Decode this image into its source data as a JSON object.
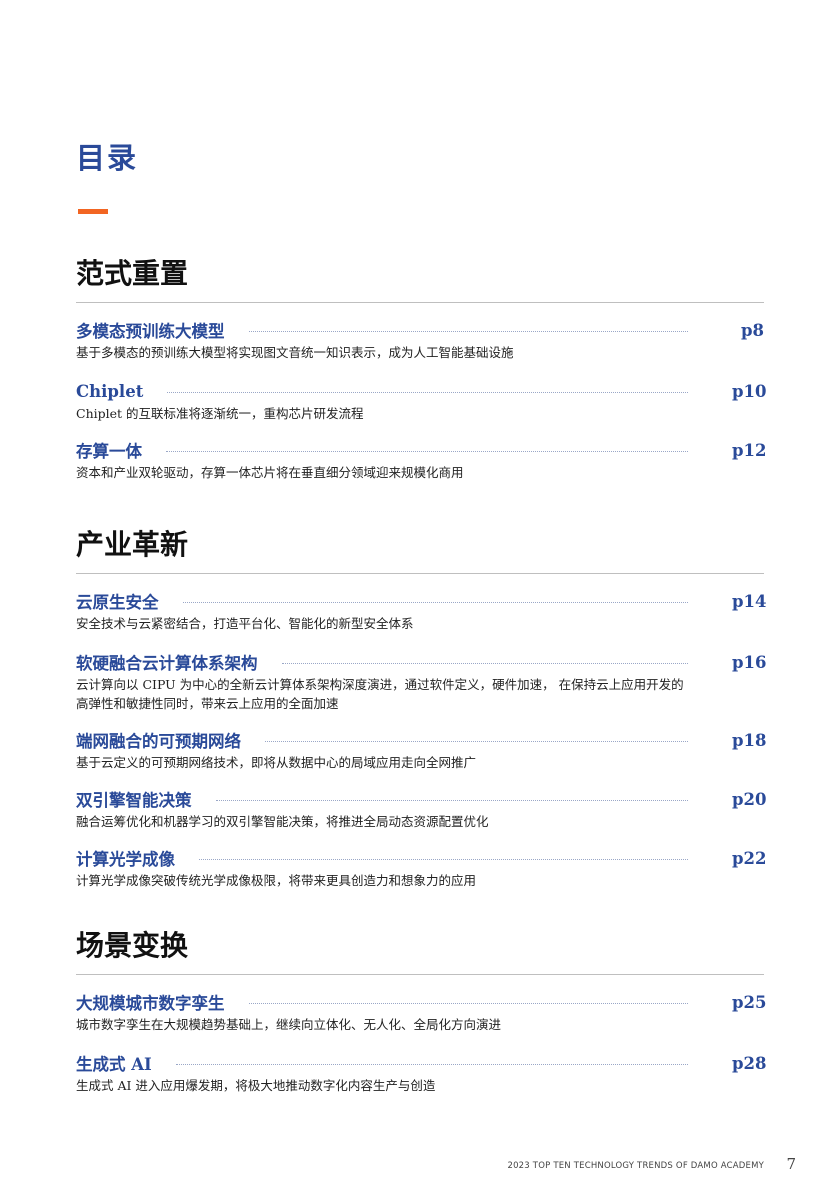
{
  "page_title": "目录",
  "sections": [
    {
      "heading": "范式重置",
      "entries": [
        {
          "title": "多模态预训练大模型",
          "page": "p8",
          "desc": "基于多模态的预训练大模型将实现图文音统一知识表示，成为人工智能基础设施"
        },
        {
          "title": "Chiplet",
          "page": "p10",
          "desc": "Chiplet 的互联标准将逐渐统一，重构芯片研发流程"
        },
        {
          "title": "存算一体",
          "page": "p12",
          "desc": "资本和产业双轮驱动，存算一体芯片将在垂直细分领域迎来规模化商用"
        }
      ]
    },
    {
      "heading": "产业革新",
      "entries": [
        {
          "title": "云原生安全",
          "page": "p14",
          "desc": "安全技术与云紧密结合，打造平台化、智能化的新型安全体系"
        },
        {
          "title": "软硬融合云计算体系架构",
          "page": "p16",
          "desc": "云计算向以 CIPU 为中心的全新云计算体系架构深度演进，通过软件定义，硬件加速， 在保持云上应用开发的高弹性和敏捷性同时，带来云上应用的全面加速"
        },
        {
          "title": "端网融合的可预期网络",
          "page": "p18",
          "desc": "基于云定义的可预期网络技术，即将从数据中心的局域应用走向全网推广"
        },
        {
          "title": "双引擎智能决策",
          "page": "p20",
          "desc": "融合运筹优化和机器学习的双引擎智能决策，将推进全局动态资源配置优化"
        },
        {
          "title": "计算光学成像",
          "page": "p22",
          "desc": "计算光学成像突破传统光学成像极限，将带来更具创造力和想象力的应用"
        }
      ]
    },
    {
      "heading": "场景变换",
      "entries": [
        {
          "title": "大规模城市数字孪生",
          "page": "p25",
          "desc": "城市数字孪生在大规模趋势基础上，继续向立体化、无人化、全局化方向演进"
        },
        {
          "title": "生成式 AI",
          "page": "p28",
          "desc": "生成式 AI 进入应用爆发期，将极大地推动数字化内容生产与创造"
        }
      ]
    }
  ],
  "footer": {
    "text": "2023 TOP TEN TECHNOLOGY TRENDS OF DAMO ACADEMY",
    "page_number": "7"
  }
}
